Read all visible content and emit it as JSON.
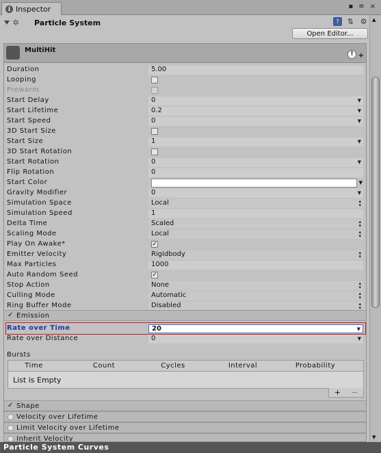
{
  "tab": {
    "label": "Inspector",
    "controls": [
      "▪",
      "≡",
      "×"
    ]
  },
  "component": {
    "title": "Particle System",
    "open_editor_label": "Open Editor..."
  },
  "main": {
    "title": "MultiHit",
    "properties": [
      {
        "label": "Duration",
        "kind": "field",
        "value": "5.00"
      },
      {
        "label": "Looping",
        "kind": "check",
        "checked": false
      },
      {
        "label": "Prewarm",
        "kind": "check",
        "checked": false,
        "disabled": true
      },
      {
        "label": "Start Delay",
        "kind": "field-arrow",
        "value": "0"
      },
      {
        "label": "Start Lifetime",
        "kind": "field-arrow",
        "value": "0.2"
      },
      {
        "label": "Start Speed",
        "kind": "field-arrow",
        "value": "0"
      },
      {
        "label": "3D Start Size",
        "kind": "check",
        "checked": false
      },
      {
        "label": "Start Size",
        "kind": "field-arrow",
        "value": "1"
      },
      {
        "label": "3D Start Rotation",
        "kind": "check",
        "checked": false
      },
      {
        "label": "Start Rotation",
        "kind": "field-arrow",
        "value": "0"
      },
      {
        "label": "Flip Rotation",
        "kind": "field",
        "value": "0"
      },
      {
        "label": "Start Color",
        "kind": "color",
        "color": "#ffffff"
      },
      {
        "label": "Gravity Modifier",
        "kind": "field-arrow",
        "value": "0"
      },
      {
        "label": "Simulation Space",
        "kind": "dropdown",
        "value": "Local"
      },
      {
        "label": "Simulation Speed",
        "kind": "field",
        "value": "1"
      },
      {
        "label": "Delta Time",
        "kind": "dropdown",
        "value": "Scaled"
      },
      {
        "label": "Scaling Mode",
        "kind": "dropdown",
        "value": "Local"
      },
      {
        "label": "Play On Awake*",
        "kind": "check",
        "checked": true
      },
      {
        "label": "Emitter Velocity",
        "kind": "dropdown",
        "value": "Rigidbody"
      },
      {
        "label": "Max Particles",
        "kind": "field",
        "value": "1000"
      },
      {
        "label": "Auto Random Seed",
        "kind": "check",
        "checked": true
      },
      {
        "label": "Stop Action",
        "kind": "dropdown",
        "value": "None"
      },
      {
        "label": "Culling Mode",
        "kind": "dropdown",
        "value": "Automatic"
      },
      {
        "label": "Ring Buffer Mode",
        "kind": "dropdown",
        "value": "Disabled"
      }
    ]
  },
  "emission": {
    "label": "Emission",
    "check_mark": "✓",
    "rate_over_time_label": "Rate over Time",
    "rate_over_time_value": "20",
    "rate_over_distance_label": "Rate over Distance",
    "rate_over_distance_value": "0",
    "bursts_label": "Bursts",
    "bursts_columns": [
      "Time",
      "Count",
      "Cycles",
      "Interval",
      "Probability"
    ],
    "bursts_empty": "List is Empty",
    "add_label": "+",
    "remove_label": "−"
  },
  "modules": [
    {
      "label": "Shape",
      "enabled": true
    },
    {
      "label": "Velocity over Lifetime",
      "enabled": false
    },
    {
      "label": "Limit Velocity over Lifetime",
      "enabled": false
    },
    {
      "label": "Inherit Velocity",
      "enabled": false
    }
  ],
  "footer": {
    "label": "Particle System Curves"
  }
}
